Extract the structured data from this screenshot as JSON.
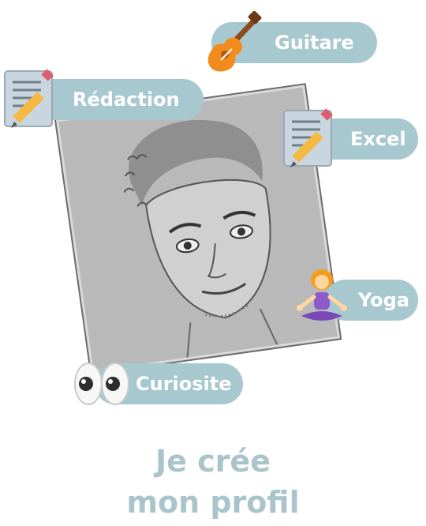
{
  "tags": {
    "guitare": "Guitare",
    "redaction": "Rédaction",
    "excel": "Excel",
    "yoga": "Yoga",
    "curiosite": "Curiosite"
  },
  "caption": {
    "line1": "Je crée",
    "line2": "mon profil"
  },
  "icons": {
    "guitare": "guitar-icon",
    "redaction": "memo-pencil-icon",
    "excel": "memo-pencil-icon",
    "yoga": "person-lotus-icon",
    "curiosite": "eyes-icon"
  },
  "colors": {
    "tag_background": "#a8c8cf",
    "tag_text": "#ffffff",
    "caption_text": "#a9c4ca"
  }
}
